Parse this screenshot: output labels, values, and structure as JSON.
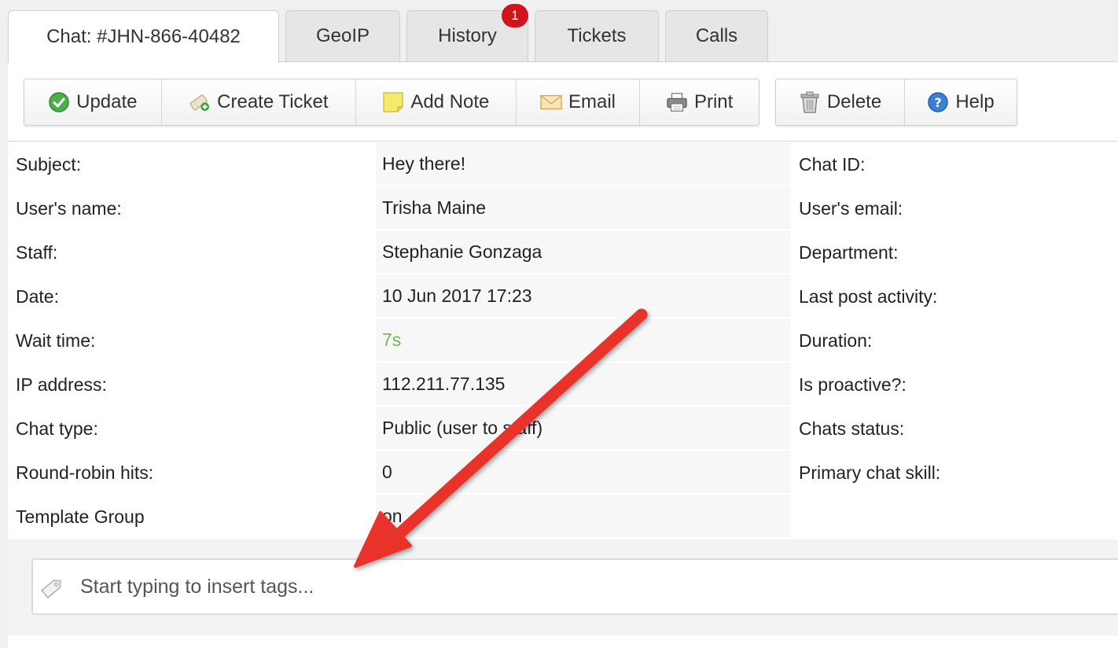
{
  "tabs": [
    {
      "label": "Chat: #JHN-866-40482",
      "active": true
    },
    {
      "label": "GeoIP",
      "active": false
    },
    {
      "label": "History",
      "active": false,
      "badge": "1"
    },
    {
      "label": "Tickets",
      "active": false
    },
    {
      "label": "Calls",
      "active": false
    }
  ],
  "toolbar": {
    "update": "Update",
    "create_ticket": "Create Ticket",
    "add_note": "Add Note",
    "email": "Email",
    "print": "Print",
    "delete": "Delete",
    "help": "Help"
  },
  "details": {
    "rows": [
      {
        "label": "Subject:",
        "value": "Hey there!",
        "right_label": "Chat ID:"
      },
      {
        "label": "User's name:",
        "value": "Trisha Maine",
        "right_label": "User's email:"
      },
      {
        "label": "Staff:",
        "value": "Stephanie Gonzaga",
        "right_label": "Department:"
      },
      {
        "label": "Date:",
        "value": "10 Jun 2017 17:23",
        "right_label": "Last post activity:"
      },
      {
        "label": "Wait time:",
        "value": "7s",
        "right_label": "Duration:"
      },
      {
        "label": "IP address:",
        "value": "112.211.77.135",
        "right_label": "Is proactive?:"
      },
      {
        "label": "Chat type:",
        "value": "Public (user to staff)",
        "right_label": "Chats status:"
      },
      {
        "label": "Round-robin hits:",
        "value": "0",
        "right_label": "Primary chat skill:"
      },
      {
        "label": "Template Group",
        "value": "on",
        "right_label": ""
      }
    ]
  },
  "tags": {
    "placeholder": "Start typing to insert tags..."
  },
  "colors": {
    "wait_time": "#77b55a",
    "badge": "#d0141a",
    "arrow": "#e8332a"
  },
  "icons": [
    "check-circle-icon",
    "ticket-plus-icon",
    "note-icon",
    "envelope-icon",
    "printer-icon",
    "trash-icon",
    "help-icon",
    "tag-icon",
    "annotation-arrow"
  ]
}
